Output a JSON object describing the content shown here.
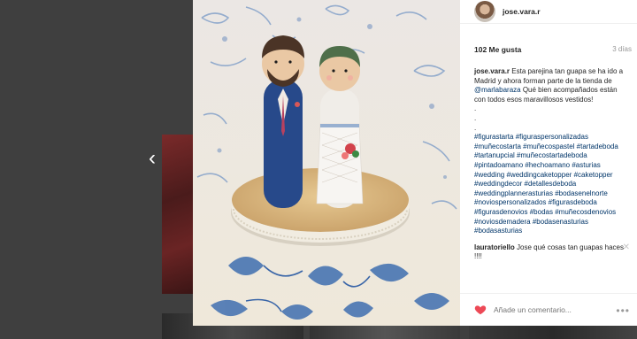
{
  "post": {
    "username": "jose.vara.r",
    "likes": "102 Me gusta",
    "time_ago": "3 días",
    "caption": {
      "user": "jose.vara.r",
      "text_before": " Esta parejina tan guapa se ha ido a Madrid y ahora forman parte de la tienda de ",
      "mention": "@marlabaraza",
      "text_after": " Qué bien acompañados están con todos esos maravillosos vestidos!",
      "dots": [
        ".",
        ".",
        "."
      ],
      "hashtags": [
        "#figurastarta",
        "#figuraspersonalizadas",
        "#muñecostarta",
        "#muñecospastel",
        "#tartadeboda",
        "#tartanupcial",
        "#muñecostartadeboda",
        "#pintadoamano",
        "#hechoamano",
        "#asturias",
        "#wedding",
        "#weddingcaketopper",
        "#caketopper",
        "#weddingdecor",
        "#detallesdeboda",
        "#weddingplannerasturias",
        "#bodasenelnorte",
        "#noviospersonalizados",
        "#figurasdeboda",
        "#figurasdenovios",
        "#bodas",
        "#muñecosdenovios",
        "#noviosdemadera",
        "#bodasenasturias",
        "#bodasasturias"
      ]
    },
    "comment": {
      "user": "lauratoriello",
      "text": " Jose qué cosas tan guapas haces !!!!"
    },
    "composer": {
      "placeholder": "Añade un comentario..."
    }
  },
  "nav": {
    "prev_icon": "chevron-left-icon",
    "prev_glyph": "‹"
  },
  "colors": {
    "link": "#003569",
    "heart": "#ed4956",
    "text": "#262626",
    "muted": "#999999"
  }
}
